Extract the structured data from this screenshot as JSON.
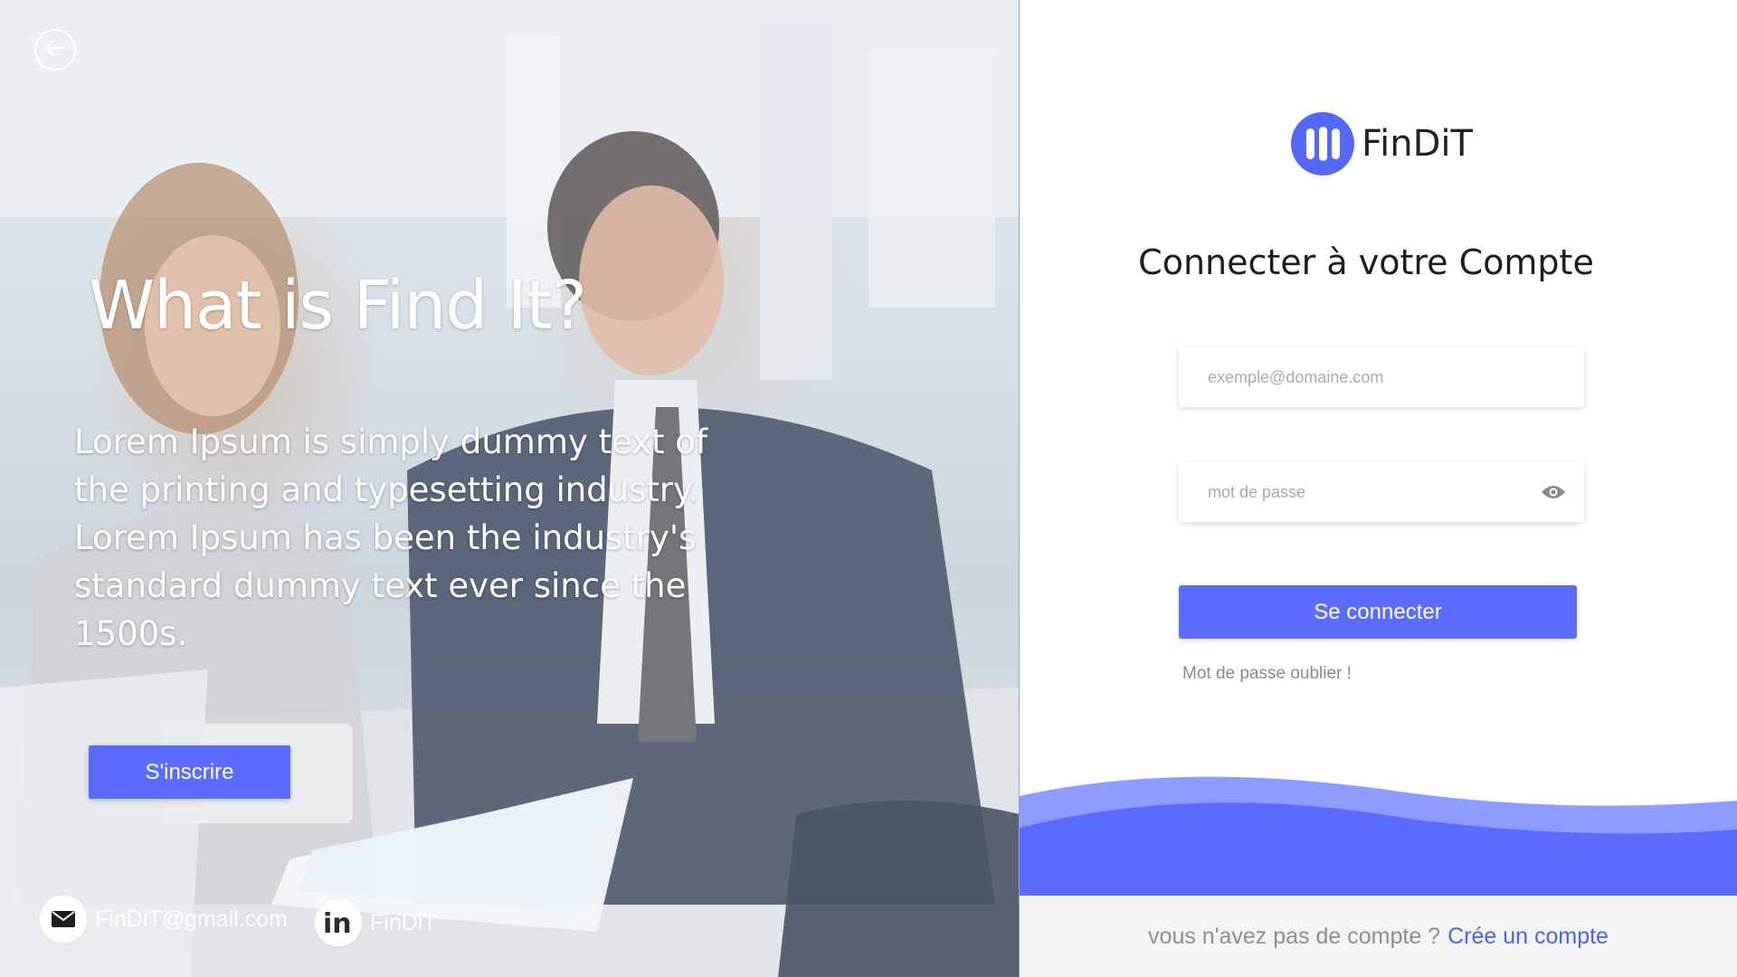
{
  "hero": {
    "title": "What is Find It?",
    "description": "Lorem Ipsum is simply dummy text of the printing and typesetting industry. Lorem Ipsum has been the industry's standard dummy text ever since the 1500s.",
    "signup_label": "S'inscrire"
  },
  "contacts": {
    "email": "FinDiT@gmail.com",
    "linkedin": "FinDiT"
  },
  "brand": {
    "name": "FinDiT",
    "accent_color": "#5a6cff"
  },
  "login": {
    "title": "Connecter à votre Compte",
    "email_placeholder": "exemple@domaine.com",
    "password_placeholder": "mot de passe",
    "submit_label": "Se connecter",
    "forgot_label": "Mot de passe oublier !"
  },
  "footer": {
    "prompt": "vous n'avez pas de compte ?",
    "create_link": "Crée un compte"
  },
  "icons": {
    "back": "arrow-left-circle-icon",
    "email": "envelope-icon",
    "linkedin": "linkedin-icon",
    "eye": "eye-icon"
  }
}
